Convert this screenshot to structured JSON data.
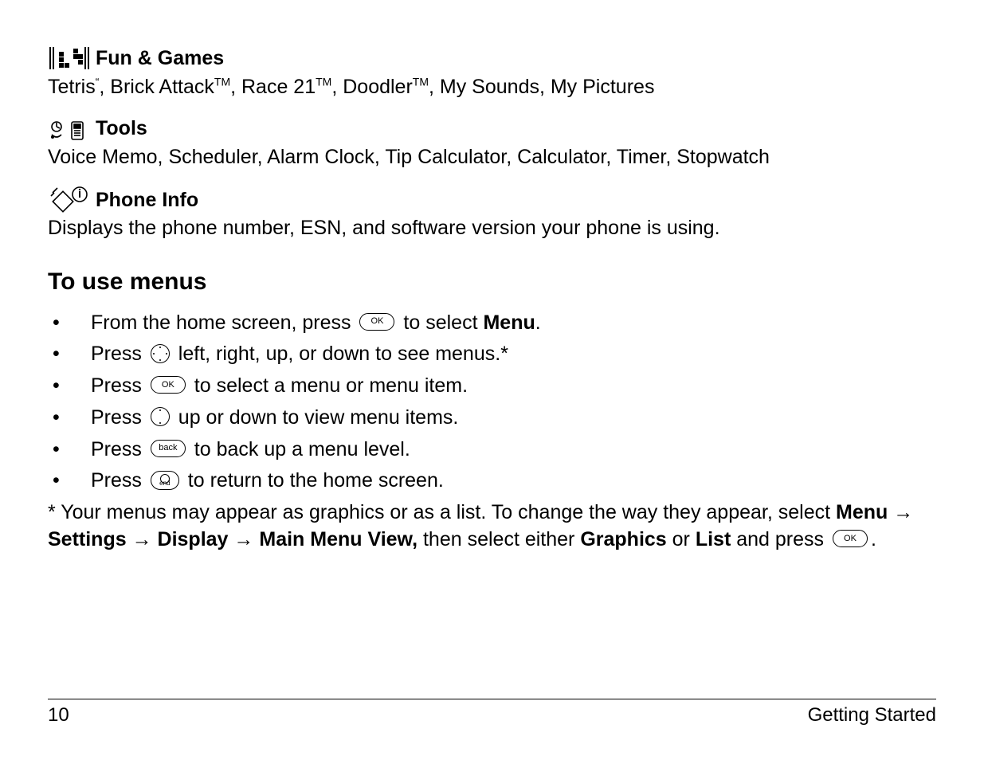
{
  "sections": {
    "fun_games": {
      "title": "Fun & Games",
      "items_pre": "Tetris",
      "items_post": ", Brick Attack",
      "items_post2": ", Race 21",
      "items_post3": ", Doodler",
      "items_tail": ", My Sounds, My Pictures",
      "tm": "TM",
      "quote": "“"
    },
    "tools": {
      "title": "Tools",
      "body": "Voice Memo, Scheduler, Alarm Clock, Tip Calculator, Calculator, Timer, Stopwatch"
    },
    "phone_info": {
      "title": "Phone Info",
      "body": "Displays the phone number, ESN, and software version your phone is using."
    }
  },
  "heading": "To use menus",
  "buttons": {
    "ok": "OK",
    "back": "back"
  },
  "bullets": [
    {
      "pre": "From the home screen, press ",
      "btn": "ok",
      "mid": " to  select ",
      "bold": "Menu",
      "post": "."
    },
    {
      "pre": "Press ",
      "btn": "nav4",
      "post": " left, right, up, or down to see menus.*"
    },
    {
      "pre": "Press ",
      "btn": "ok",
      "post": " to select a menu or menu item."
    },
    {
      "pre": "Press ",
      "btn": "nav2",
      "post": " up or down to view menu items."
    },
    {
      "pre": "Press ",
      "btn": "back",
      "post": " to back up a menu level."
    },
    {
      "pre": "Press ",
      "btn": "end",
      "post": " to return to the home screen."
    }
  ],
  "note": {
    "pre": "* Your menus may appear as graphics or as a list. To change the way they appear, select ",
    "path": [
      "Menu",
      "Settings",
      "Display",
      "Main Menu View,"
    ],
    "mid": " then select either ",
    "opt1": "Graphics",
    "or": " or ",
    "opt2": "List",
    "post": " and press ",
    "btn": "ok",
    "end": "."
  },
  "footer": {
    "page": "10",
    "chapter": "Getting Started"
  }
}
